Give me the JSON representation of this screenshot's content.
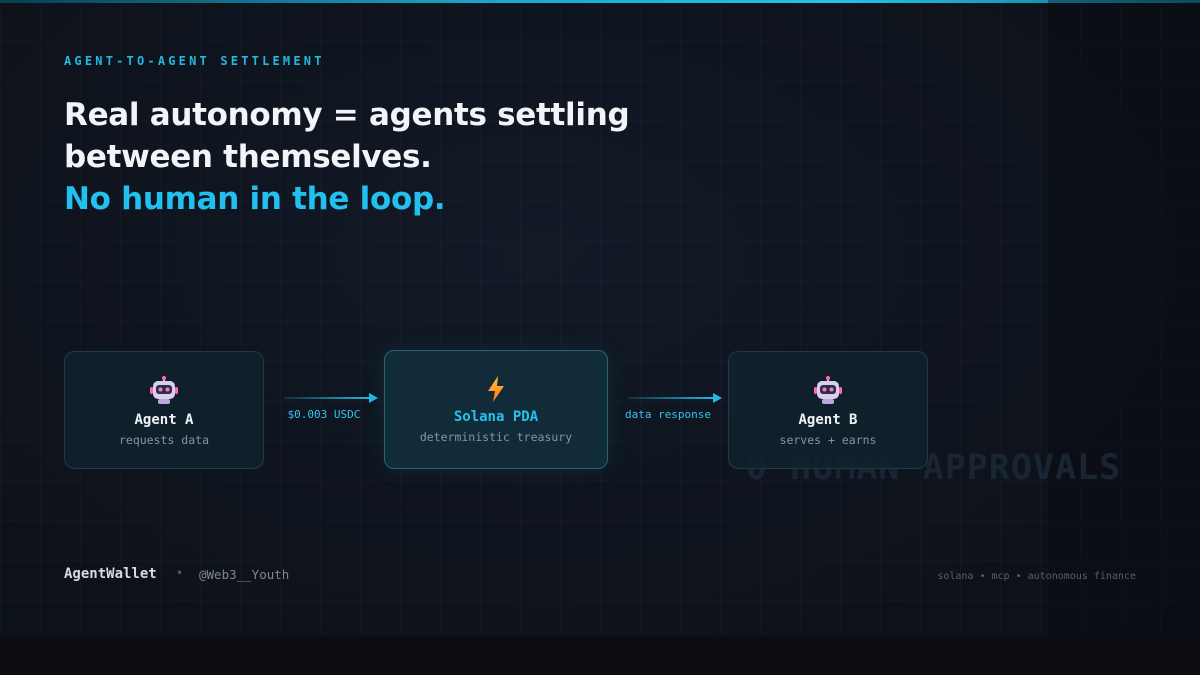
{
  "eyebrow": "AGENT-TO-AGENT SETTLEMENT",
  "headline": {
    "line1": "Real autonomy = agents settling",
    "line2": "between themselves.",
    "line3": "No human in the loop."
  },
  "flow": {
    "agent_a": {
      "icon": "robot-icon",
      "title": "Agent A",
      "subtitle": "requests data"
    },
    "connector_1": {
      "label": "$0.003 USDC"
    },
    "pda": {
      "icon": "lightning-icon",
      "title": "Solana PDA",
      "subtitle": "deterministic treasury"
    },
    "connector_2": {
      "label": "data response"
    },
    "agent_b": {
      "icon": "robot-icon",
      "title": "Agent B",
      "subtitle": "serves + earns"
    }
  },
  "watermark": "0 HUMAN APPROVALS",
  "footer": {
    "brand": "AgentWallet",
    "separator": "•",
    "handle": "@Web3__Youth",
    "tags": "solana • mcp • autonomous finance"
  },
  "colors": {
    "accent": "#22b8e0",
    "headline_accent": "#21c0ee",
    "background": "#0d1117"
  }
}
